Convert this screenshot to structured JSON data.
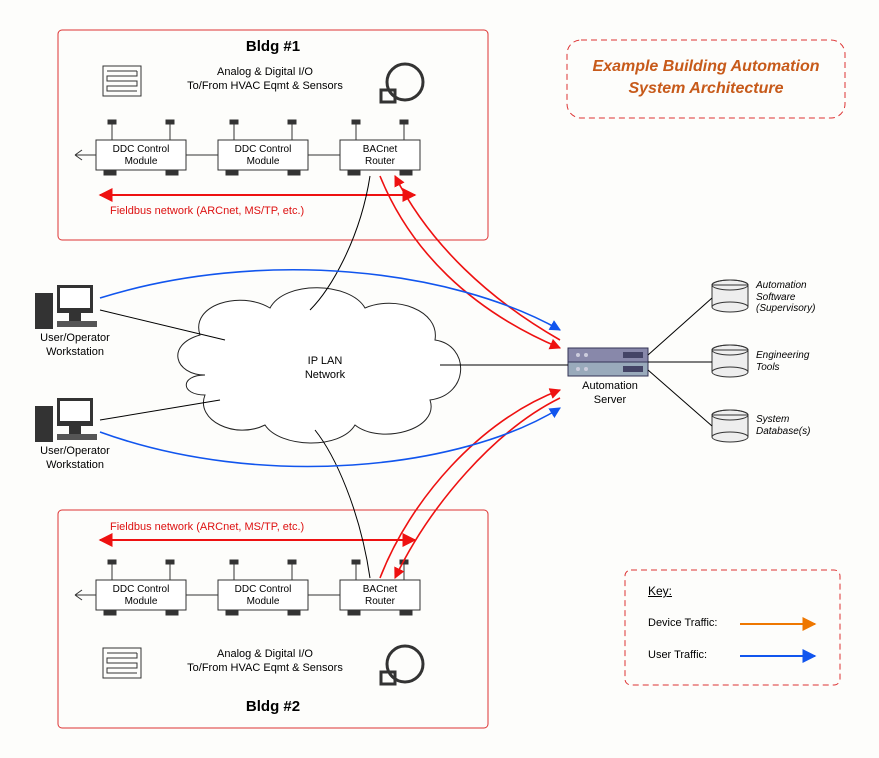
{
  "diagram": {
    "main_title_l1": "Example Building Automation",
    "main_title_l2": "System Architecture",
    "buildings": {
      "b1": {
        "title": "Bldg #1",
        "io_text_l1": "Analog & Digital I/O",
        "io_text_l2": "To/From HVAC Eqmt & Sensors",
        "ddc1": "DDC Control\nModule",
        "ddc2": "DDC Control\nModule",
        "router": "BACnet\nRouter",
        "fieldbus": "Fieldbus network (ARCnet, MS/TP, etc.)"
      },
      "b2": {
        "title": "Bldg #2",
        "io_text_l1": "Analog & Digital I/O",
        "io_text_l2": "To/From HVAC Eqmt & Sensors",
        "ddc1": "DDC Control\nModule",
        "ddc2": "DDC Control\nModule",
        "router": "BACnet\nRouter",
        "fieldbus": "Fieldbus network (ARCnet, MS/TP, etc.)"
      }
    },
    "workstation1": "User/Operator\nWorkstation",
    "workstation2": "User/Operator\nWorkstation",
    "lan": "IP LAN\nNetwork",
    "server": "Automation\nServer",
    "db1": "Automation\nSoftware\n(Supervisory)",
    "db2": "Engineering\nTools",
    "db3": "System\nDatabase(s)",
    "key": {
      "title": "Key:",
      "device": "Device Traffic:",
      "user": "User Traffic:"
    }
  }
}
